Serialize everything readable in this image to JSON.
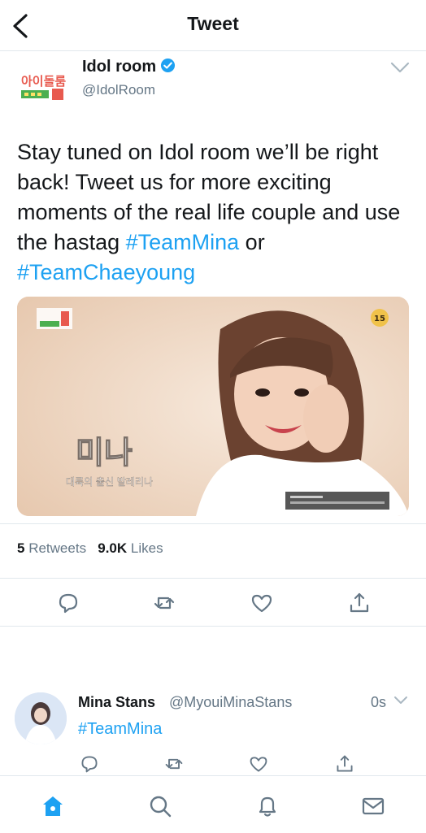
{
  "header": {
    "title": "Tweet"
  },
  "tweet": {
    "author_name": "Idol room",
    "author_handle": "@IdolRoom",
    "logo_text": "아이돌룸",
    "body_prefix": "Stay tuned on Idol room we’ll be right back! Tweet us for more exciting moments of the real life couple and use the hastag ",
    "hashtag1": "#TeamMina",
    "body_middle": " or ",
    "hashtag2": "#TeamChaeyoung",
    "media": {
      "caption_big": "미나",
      "caption_small": "대륙의 출신 발레리나",
      "rating": "15"
    },
    "retweets_count": "5",
    "retweets_label": "Retweets",
    "likes_count": "9.0K",
    "likes_label": "Likes"
  },
  "reply": {
    "name": "Mina Stans",
    "handle": "@MyouiMinaStans",
    "time": "0s",
    "text": "#TeamMina"
  },
  "colors": {
    "accent": "#1da1f2",
    "secondary_text": "#657786",
    "divider": "#e1e8ed"
  },
  "icons": [
    "back-icon",
    "verified-icon",
    "chevron-down-icon",
    "reply-icon",
    "retweet-icon",
    "like-icon",
    "share-icon",
    "home-icon",
    "search-icon",
    "notifications-icon",
    "messages-icon"
  ]
}
